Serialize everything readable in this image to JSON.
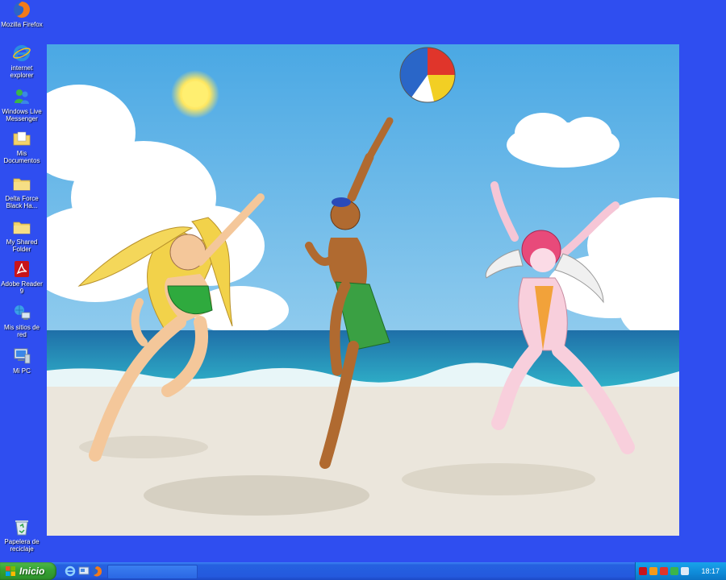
{
  "desktop": {
    "icons": [
      {
        "label": "Mozilla Firefox",
        "icon": "firefox-icon"
      },
      {
        "label": "internet explorer",
        "icon": "internet-explorer-icon"
      },
      {
        "label": "Windows Live Messenger",
        "icon": "messenger-icon"
      },
      {
        "label": "Mis Documentos",
        "icon": "documents-folder-icon"
      },
      {
        "label": "Delta Force Black Ha...",
        "icon": "folder-icon"
      },
      {
        "label": "My Shared Folder",
        "icon": "folder-icon"
      },
      {
        "label": "Adobe Reader 9",
        "icon": "adobe-reader-icon"
      },
      {
        "label": "Mis sitios de red",
        "icon": "network-places-icon"
      },
      {
        "label": "Mi PC",
        "icon": "my-computer-icon"
      },
      {
        "label": "Papelera de reciclaje",
        "icon": "recycle-bin-icon"
      }
    ],
    "background_color": "#2f4ef0"
  },
  "taskbar": {
    "start_label": "Inicio",
    "quick_launch": [
      "internet-explorer-icon",
      "show-desktop-icon",
      "firefox-icon"
    ],
    "tray_icons": [
      "adobe-tray-icon",
      "antivirus-tray-icon",
      "network-tray-icon",
      "messenger-tray-icon",
      "volume-tray-icon"
    ],
    "clock": "18:17"
  }
}
